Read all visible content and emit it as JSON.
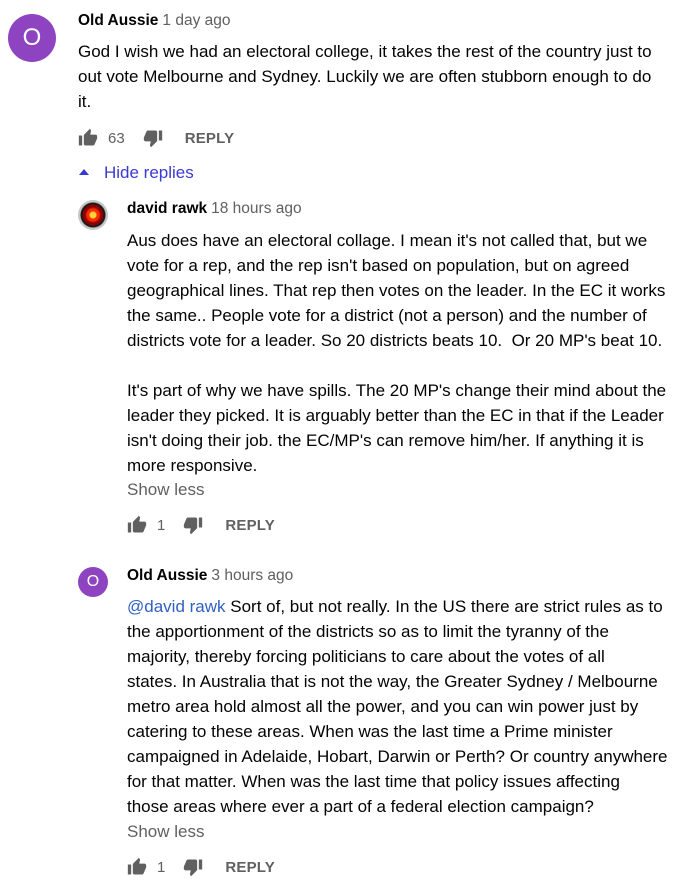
{
  "comments": [
    {
      "avatar_letter": "O",
      "author": "Old Aussie",
      "time": "1 day ago",
      "text": "God I wish we had an electoral college, it takes the rest of the country just to\nout vote Melbourne and Sydney. Luckily we are often stubborn enough to do\nit.",
      "likes": "63",
      "reply_label": "REPLY"
    }
  ],
  "replies_toggle": {
    "label": "Hide replies"
  },
  "replies": [
    {
      "author": "david rawk",
      "time": "18 hours ago",
      "text": "Aus does have an electoral collage. I mean it's not called that, but we\nvote for a rep, and the rep isn't based on population, but on agreed\ngeographical lines. That rep then votes on the leader. In the EC it works\nthe same.. People vote for a district (not a person) and the number of\ndistricts vote for a leader. So 20 districts beats 10.  Or 20 MP's beat 10.\n\nIt's part of why we have spills. The 20 MP's change their mind about the\nleader they picked. It is arguably better than the EC in that if the Leader\nisn't doing their job. the EC/MP's can remove him/her. If anything it is\nmore responsive.",
      "show_less": "Show less",
      "likes": "1",
      "reply_label": "REPLY"
    },
    {
      "avatar_letter": "O",
      "author": "Old Aussie",
      "time": "3 hours ago",
      "mention": "@david rawk",
      "text": " Sort of, but not really. In the US there are strict rules as to\nthe apportionment of the districts so as to limit the tyranny of the\nmajority, thereby forcing politicians to care about the votes of all\nstates. In Australia that is not the way, the Greater Sydney / Melbourne\nmetro area hold almost all the power, and you can win power just by\ncatering to these areas. When was the last time a Prime minister\ncampaigned in Adelaide, Hobart, Darwin or Perth? Or country anywhere\nfor that matter. When was the last time that policy issues affecting\nthose areas where ever a part of a federal election campaign?",
      "show_less": "Show less",
      "likes": "1",
      "reply_label": "REPLY"
    }
  ],
  "colors": {
    "avatar_purple": "#8e44c0",
    "link_blue": "#3a3ad0",
    "secondary_text": "#606060"
  },
  "icons": {
    "like": "thumbs-up-icon",
    "dislike": "thumbs-down-icon",
    "collapse": "caret-up-icon"
  }
}
